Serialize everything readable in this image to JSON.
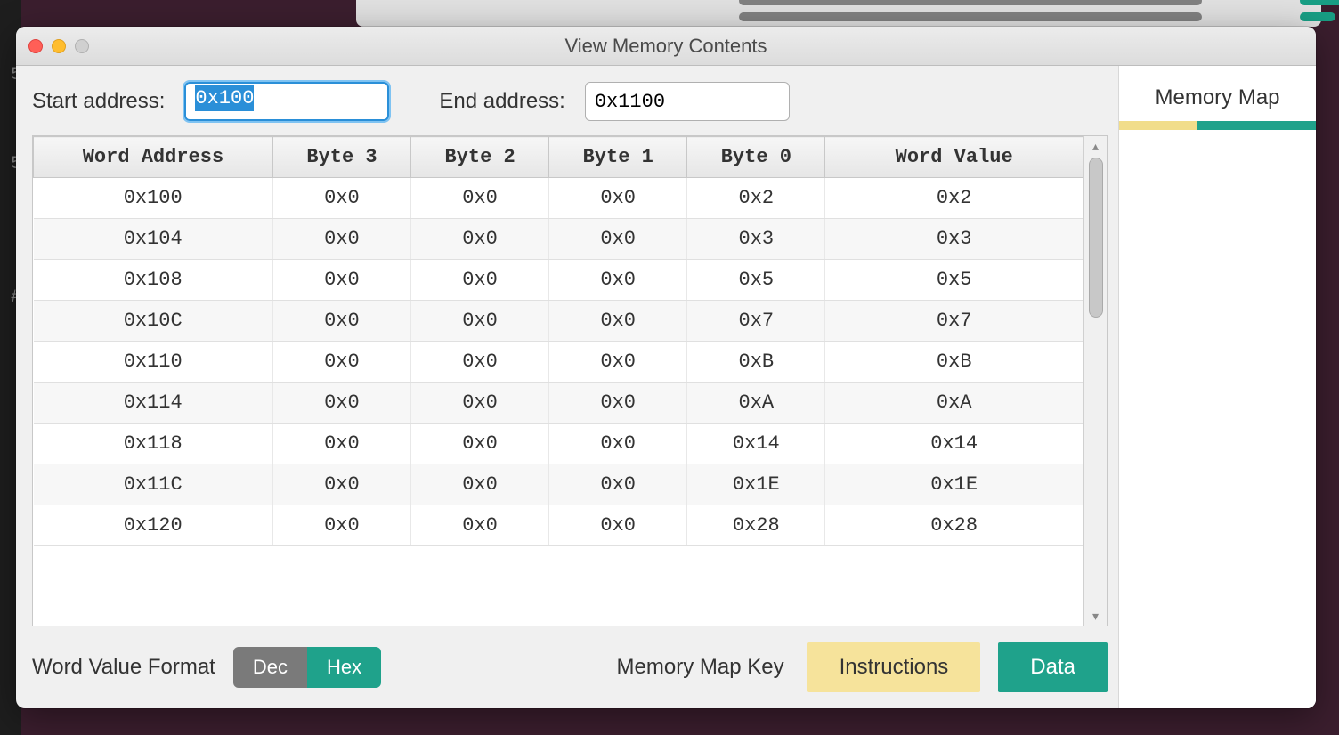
{
  "window": {
    "title": "View Memory Contents"
  },
  "inputs": {
    "start_label": "Start address:",
    "start_value": "0x100",
    "end_label": "End address:",
    "end_value": "0x1100"
  },
  "table": {
    "headers": [
      "Word Address",
      "Byte 3",
      "Byte 2",
      "Byte 1",
      "Byte 0",
      "Word Value"
    ],
    "rows": [
      {
        "addr": "0x100",
        "b3": "0x0",
        "b2": "0x0",
        "b1": "0x0",
        "b0": "0x2",
        "val": "0x2"
      },
      {
        "addr": "0x104",
        "b3": "0x0",
        "b2": "0x0",
        "b1": "0x0",
        "b0": "0x3",
        "val": "0x3"
      },
      {
        "addr": "0x108",
        "b3": "0x0",
        "b2": "0x0",
        "b1": "0x0",
        "b0": "0x5",
        "val": "0x5"
      },
      {
        "addr": "0x10C",
        "b3": "0x0",
        "b2": "0x0",
        "b1": "0x0",
        "b0": "0x7",
        "val": "0x7"
      },
      {
        "addr": "0x110",
        "b3": "0x0",
        "b2": "0x0",
        "b1": "0x0",
        "b0": "0xB",
        "val": "0xB"
      },
      {
        "addr": "0x114",
        "b3": "0x0",
        "b2": "0x0",
        "b1": "0x0",
        "b0": "0xA",
        "val": "0xA"
      },
      {
        "addr": "0x118",
        "b3": "0x0",
        "b2": "0x0",
        "b1": "0x0",
        "b0": "0x14",
        "val": "0x14"
      },
      {
        "addr": "0x11C",
        "b3": "0x0",
        "b2": "0x0",
        "b1": "0x0",
        "b0": "0x1E",
        "val": "0x1E"
      },
      {
        "addr": "0x120",
        "b3": "0x0",
        "b2": "0x0",
        "b1": "0x0",
        "b0": "0x28",
        "val": "0x28"
      }
    ]
  },
  "footer": {
    "format_label": "Word Value Format",
    "dec_label": "Dec",
    "hex_label": "Hex",
    "key_label": "Memory Map Key",
    "instructions_label": "Instructions",
    "data_label": "Data"
  },
  "side": {
    "title": "Memory Map"
  },
  "colors": {
    "teal": "#1fa28b",
    "yellow": "#f6e39b",
    "gray_btn": "#7a7a7a"
  }
}
